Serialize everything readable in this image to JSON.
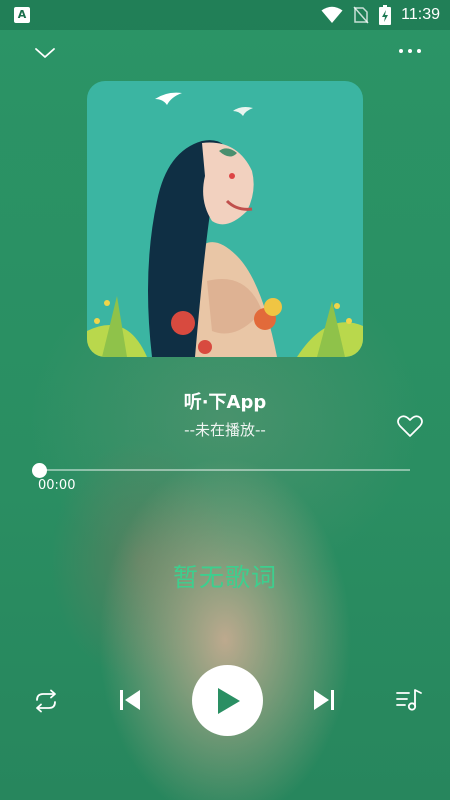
{
  "status_bar": {
    "time": "11:39",
    "app_icon_letter": "A",
    "icons": [
      "wifi-icon",
      "no-sim-icon",
      "battery-icon"
    ]
  },
  "topbar": {
    "left_icon": "chevron-down-icon",
    "right_icon": "more-icon"
  },
  "track": {
    "title": "听·下App",
    "status": "--未在播放--"
  },
  "progress": {
    "current_time": "00:00",
    "fraction": 0
  },
  "lyrics": {
    "text": "暂无歌词"
  },
  "controls": [
    "repeat-icon",
    "previous-icon",
    "play-icon",
    "next-icon",
    "playlist-icon"
  ],
  "colors": {
    "background": "#2a8f63",
    "lyrics": "#3dcf8e",
    "cover_bg": "#3bb5a2"
  }
}
